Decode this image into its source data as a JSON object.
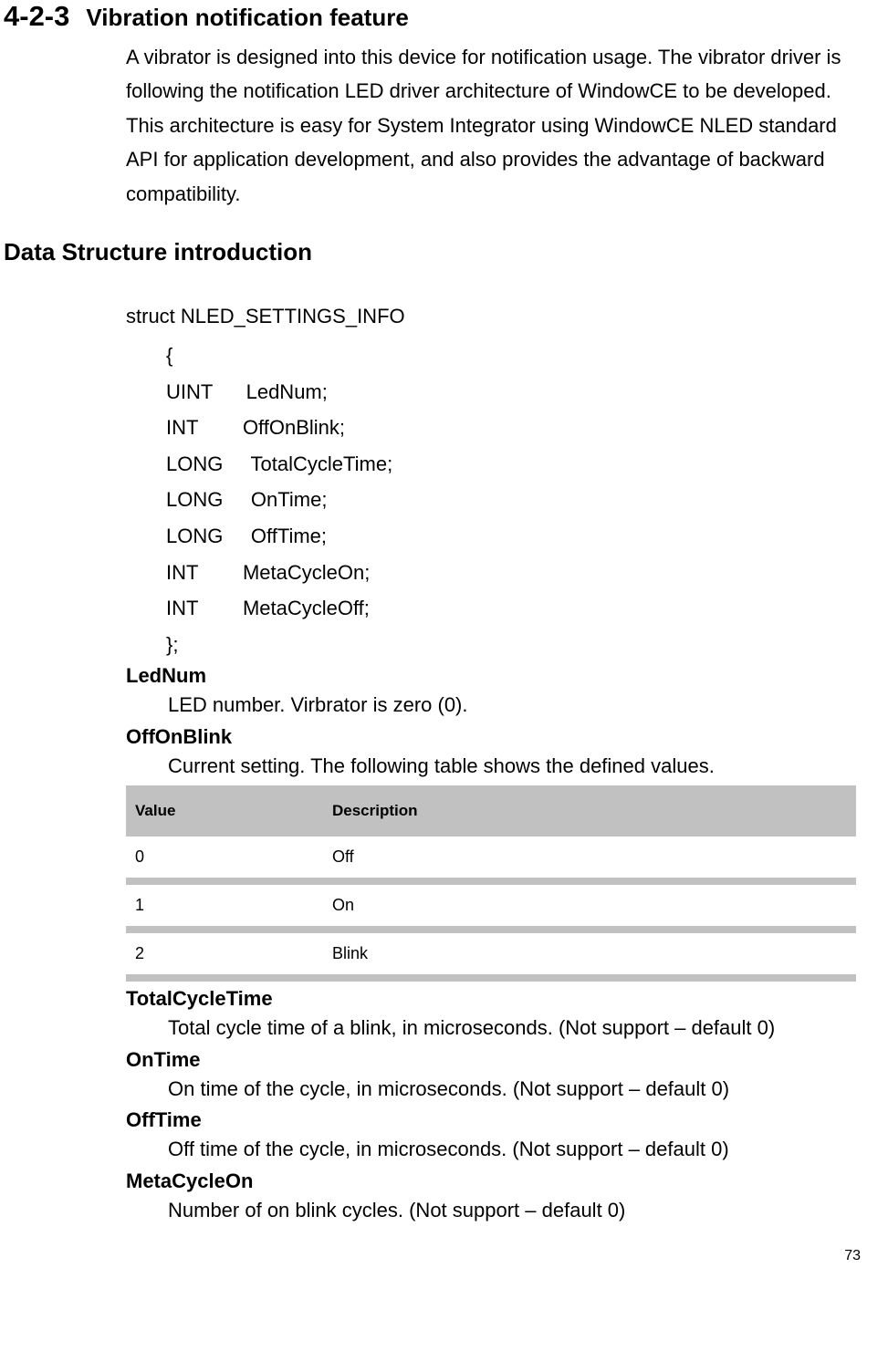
{
  "section": {
    "number": "4-2-3",
    "title": "Vibration notification feature",
    "intro": "A vibrator is designed into this device for notification usage. The vibrator driver is following the notification LED driver architecture of WindowCE to be developed. This architecture is easy for System Integrator using WindowCE NLED standard API for application development, and also provides the advantage of backward compatibility."
  },
  "subsection_title": "Data Structure introduction",
  "struct": {
    "name": "struct NLED_SETTINGS_INFO",
    "open": "{",
    "lines": [
      "UINT      LedNum;",
      "INT        OffOnBlink;",
      "LONG     TotalCycleTime;",
      "LONG     OnTime;",
      "LONG     OffTime;",
      "INT        MetaCycleOn;",
      "INT        MetaCycleOff;"
    ],
    "close": "};"
  },
  "fields": {
    "lednum": {
      "name": "LedNum",
      "desc": "LED number. Virbrator is zero (0)."
    },
    "offonblink": {
      "name": "OffOnBlink",
      "desc": "Current setting. The following table shows the defined values."
    },
    "totalcycletime": {
      "name": "TotalCycleTime",
      "desc": "Total cycle time of a blink, in microseconds. (Not support – default 0)"
    },
    "ontime": {
      "name": "OnTime",
      "desc": "On time of the cycle, in microseconds. (Not support – default 0)"
    },
    "offtime": {
      "name": "OffTime",
      "desc": "Off time of the cycle, in microseconds. (Not support – default 0)"
    },
    "metacycleon": {
      "name": "MetaCycleOn",
      "desc": "Number of on blink cycles. (Not support – default 0)"
    }
  },
  "table": {
    "headers": {
      "value": "Value",
      "description": "Description"
    },
    "rows": [
      {
        "value": "0",
        "description": "Off"
      },
      {
        "value": "1",
        "description": "On"
      },
      {
        "value": "2",
        "description": "Blink"
      }
    ]
  },
  "page_number": "73"
}
